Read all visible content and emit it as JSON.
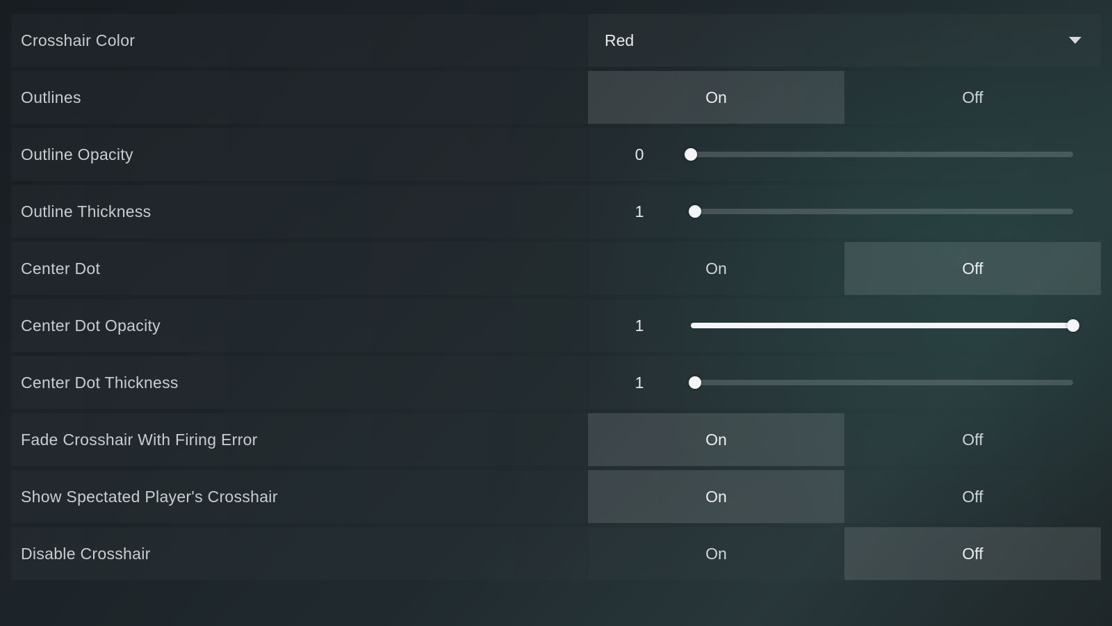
{
  "rows": [
    {
      "key": "crosshair-color",
      "label": "Crosshair Color",
      "type": "dropdown",
      "value": "Red"
    },
    {
      "key": "outlines",
      "label": "Outlines",
      "type": "toggle",
      "options": [
        "On",
        "Off"
      ],
      "selected": "On"
    },
    {
      "key": "outline-opacity",
      "label": "Outline Opacity",
      "type": "slider",
      "value": "0",
      "percent": 0
    },
    {
      "key": "outline-thickness",
      "label": "Outline Thickness",
      "type": "slider",
      "value": "1",
      "percent": 1
    },
    {
      "key": "center-dot",
      "label": "Center Dot",
      "type": "toggle",
      "options": [
        "On",
        "Off"
      ],
      "selected": "Off"
    },
    {
      "key": "center-dot-opacity",
      "label": "Center Dot Opacity",
      "type": "slider",
      "value": "1",
      "percent": 100
    },
    {
      "key": "center-dot-thickness",
      "label": "Center Dot Thickness",
      "type": "slider",
      "value": "1",
      "percent": 1
    },
    {
      "key": "fade-crosshair",
      "label": "Fade Crosshair With Firing Error",
      "type": "toggle",
      "options": [
        "On",
        "Off"
      ],
      "selected": "On"
    },
    {
      "key": "show-spectated",
      "label": "Show Spectated Player's Crosshair",
      "type": "toggle",
      "options": [
        "On",
        "Off"
      ],
      "selected": "On"
    },
    {
      "key": "disable-crosshair",
      "label": "Disable Crosshair",
      "type": "toggle",
      "options": [
        "On",
        "Off"
      ],
      "selected": "Off"
    }
  ]
}
